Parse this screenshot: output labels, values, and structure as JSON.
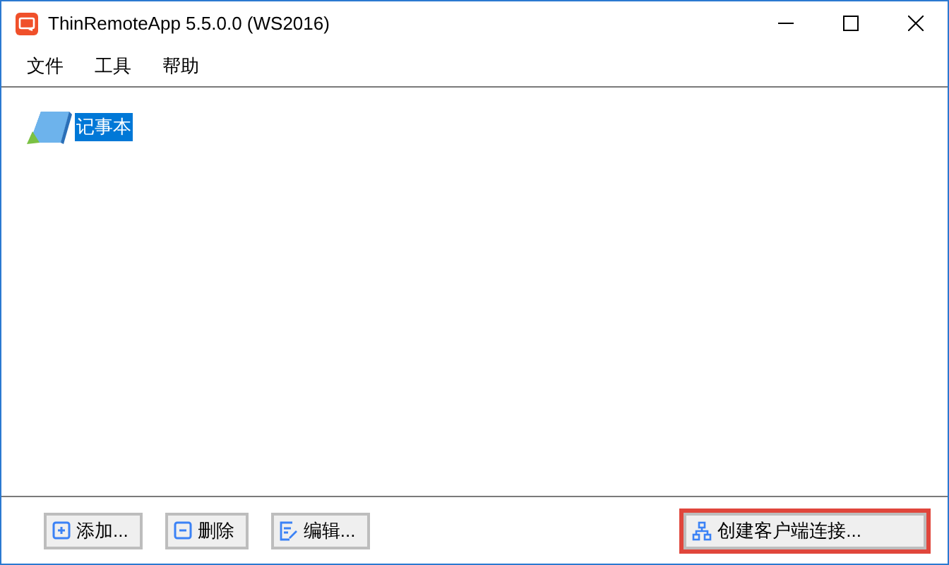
{
  "window": {
    "title": "ThinRemoteApp 5.5.0.0 (WS2016)"
  },
  "menu": [
    "文件",
    "工具",
    "帮助"
  ],
  "apps": [
    {
      "label": "记事本",
      "selected": true
    }
  ],
  "buttons": [
    {
      "label": "添加...",
      "kind": "add",
      "highlighted": false
    },
    {
      "label": "删除",
      "kind": "delete",
      "highlighted": false
    },
    {
      "label": "编辑...",
      "kind": "edit",
      "highlighted": false
    },
    {
      "label": "创建客户端连接...",
      "kind": "connect",
      "highlighted": true
    }
  ]
}
